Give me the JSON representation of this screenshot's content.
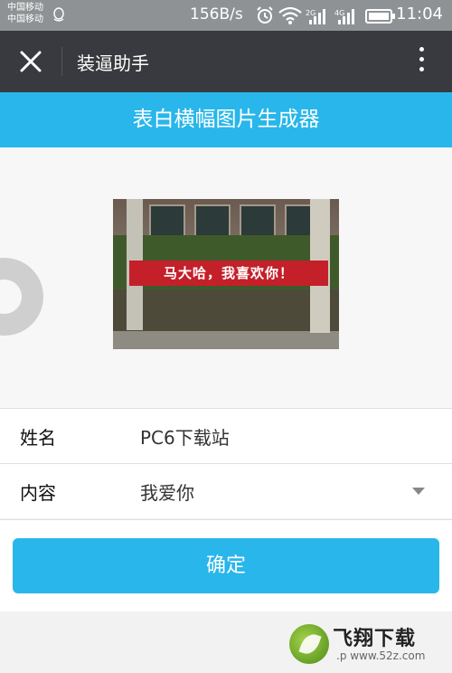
{
  "status_bar": {
    "carrier1": "中国移动",
    "carrier2": "中国移动",
    "speed": "156B/s",
    "net_tag1": "2G",
    "net_tag2": "4G",
    "time": "11:04"
  },
  "title_bar": {
    "title": "装逼助手",
    "close_icon": "close-icon",
    "more_icon": "more-vertical-icon"
  },
  "header": {
    "title": "表白横幅图片生成器"
  },
  "preview": {
    "banner_text": "马大哈，我喜欢你！"
  },
  "form": {
    "name_label": "姓名",
    "name_value": "PC6下载站",
    "content_label": "内容",
    "content_value": "我爱你"
  },
  "confirm_label": "确定",
  "watermark": {
    "title": "飞翔下载",
    "url": ".p www.52z.com"
  },
  "colors": {
    "accent": "#29b6ea",
    "titlebar": "#393a3f",
    "banner": "#c4202a"
  }
}
